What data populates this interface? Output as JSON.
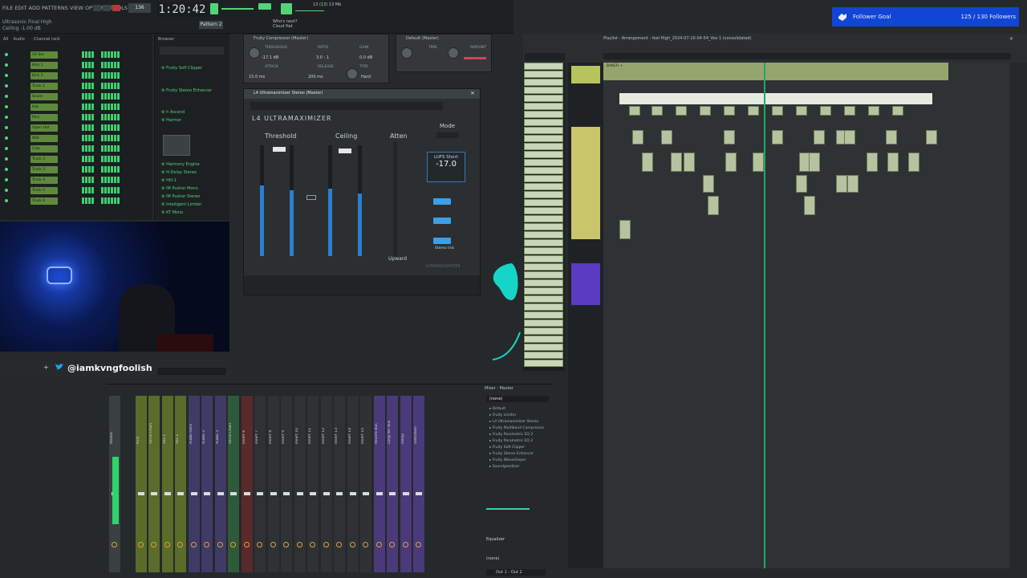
{
  "toolbar": {
    "menu": "FILE EDIT ADD PATTERNS VIEW OPTIONS TOOLS HELP",
    "hint_line1": "Ultrasonic Final High",
    "hint_line2": "Ceiling -1.00 dB",
    "time": "1:20:42",
    "pattern_label": "Pattern 2",
    "cpu_label": "13 (13) 13 Mb"
  },
  "follower_goal": {
    "label": "Follower Goal",
    "count": "125 / 130 Followers"
  },
  "channel_rack": {
    "rows": [
      "SA Snr",
      "Kick 1",
      "Kick 2",
      "Track 1",
      "Snare",
      "Hat",
      "Perc",
      "Open Hat",
      "808",
      "Clap",
      "Track 2",
      "Track 3",
      "Track 4",
      "Track 5",
      "Track 6"
    ]
  },
  "browser": {
    "items": [
      "Fruity Soft Clipper",
      "Fruity Stereo Enhancer",
      "h Ascend",
      "Harmor",
      "Harmony Engine",
      "H-Delay Stereo",
      "Hill-1",
      "IM Pusher Mono",
      "IM Pusher Stereo",
      "Intelligent Limiter",
      "KT Mono"
    ]
  },
  "social": {
    "twitter_handle": "@iamkvngfoolish"
  },
  "plugin_l4": {
    "title": "L4 Ultramaximizer Stereo (Master)",
    "brand": "L4 ULTRAMAXIMIZER",
    "threshold_label": "Threshold",
    "ceiling_label": "Ceiling",
    "atten_label": "Atten",
    "mode_label": "Mode",
    "lufs_label": "LUFS Short",
    "lufs_value": "-17.0",
    "upward_label": "Upward",
    "stereo_link": "Stereo link",
    "footer": "ULTRAMAXIMIZER"
  },
  "plugin_comp": {
    "title": "Fruity Compressor (Master)",
    "threshold": "-17.1 dB",
    "ratio": "3.0 : 1",
    "gain": "0.0 dB",
    "attack": "15.0 ms",
    "release": "200 ms",
    "type": "Hard",
    "knob_labels": [
      "THRESHOLD",
      "RATIO",
      "GAIN",
      "ATTACK",
      "RELEASE",
      "TYPE"
    ]
  },
  "plugin_delay": {
    "title": "Default (Master)",
    "knob_labels": [
      "TIME",
      "AMOUNT"
    ]
  },
  "playlist": {
    "title": "Playlist - Arrangement - feel High_2024-07-10-04-54_Vox 1 (consolidated)",
    "track_header": "BAKER +",
    "track_labels": [
      "Track 1",
      "Track 2",
      "Track 3",
      "Track 4",
      "Track 5",
      "Track 6",
      "Track 7",
      "Track 8",
      "Track 9"
    ]
  },
  "mixer": {
    "title": "Mixer - Master",
    "slot_label": "(none)",
    "channels": [
      "Master",
      "Kick",
      "Vocal Chain",
      "Vox 1",
      "Vox 2",
      "Audio Rack",
      "Audio 2",
      "Audio 3",
      "Vocal Chain",
      "Insert 6",
      "Insert 7",
      "Insert 8",
      "Insert 9",
      "Insert 10",
      "Insert 11",
      "Insert 12",
      "Insert 13",
      "Insert 14",
      "Insert 15",
      "Reverb Bus",
      "Long Ver Bus",
      "Delay",
      "Distortion"
    ],
    "fx_chain": [
      "Default",
      "Fruity Limiter",
      "L4 Ultramaximizer Stereo",
      "Fruity Multiband Compressor",
      "Fruity Parametric EQ 2",
      "Fruity Parametric EQ 2",
      "Fruity Soft Clipper",
      "Fruity Stereo Enhancer",
      "Fruity Waveshaper",
      "Soundgoodizer"
    ],
    "equalizer_label": "Equalizer",
    "output_label": "Out 1 - Out 2"
  },
  "colors": {
    "accent_green": "#55d27a",
    "follower_blue": "#1245d6",
    "l4_blue": "#3aa0e8",
    "pattern_clip": "#c9d6b8"
  }
}
